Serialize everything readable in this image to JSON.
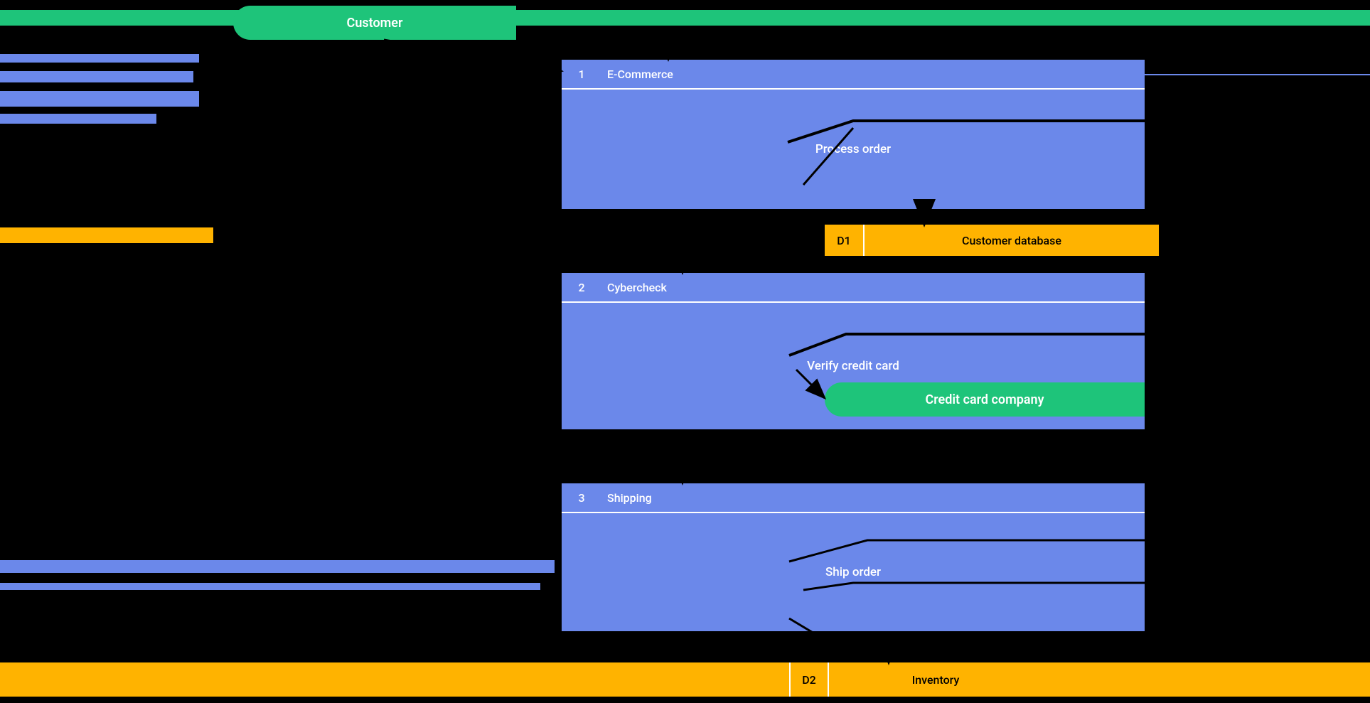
{
  "entities": {
    "customer": "Customer",
    "credit_card_company": "Credit card company"
  },
  "processes": [
    {
      "num": "1",
      "title": "E-Commerce",
      "body": "Process order"
    },
    {
      "num": "2",
      "title": "Cybercheck",
      "body": "Verify credit card"
    },
    {
      "num": "3",
      "title": "Shipping",
      "body": "Ship order"
    }
  ],
  "datastores": [
    {
      "id": "D1",
      "label": "Customer database"
    },
    {
      "id": "D2",
      "label": "Inventory"
    }
  ],
  "colors": {
    "entity": "#1ec47a",
    "process": "#6b88ea",
    "datastore": "#ffb300",
    "bg": "#000000"
  }
}
